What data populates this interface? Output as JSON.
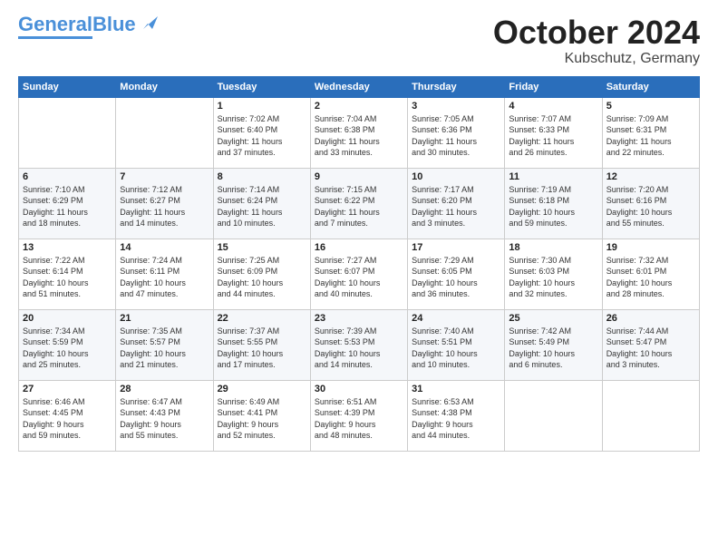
{
  "logo": {
    "text1": "General",
    "text2": "Blue"
  },
  "title": "October 2024",
  "subtitle": "Kubschutz, Germany",
  "days": [
    "Sunday",
    "Monday",
    "Tuesday",
    "Wednesday",
    "Thursday",
    "Friday",
    "Saturday"
  ],
  "weeks": [
    [
      {
        "day": "",
        "content": ""
      },
      {
        "day": "",
        "content": ""
      },
      {
        "day": "1",
        "content": "Sunrise: 7:02 AM\nSunset: 6:40 PM\nDaylight: 11 hours\nand 37 minutes."
      },
      {
        "day": "2",
        "content": "Sunrise: 7:04 AM\nSunset: 6:38 PM\nDaylight: 11 hours\nand 33 minutes."
      },
      {
        "day": "3",
        "content": "Sunrise: 7:05 AM\nSunset: 6:36 PM\nDaylight: 11 hours\nand 30 minutes."
      },
      {
        "day": "4",
        "content": "Sunrise: 7:07 AM\nSunset: 6:33 PM\nDaylight: 11 hours\nand 26 minutes."
      },
      {
        "day": "5",
        "content": "Sunrise: 7:09 AM\nSunset: 6:31 PM\nDaylight: 11 hours\nand 22 minutes."
      }
    ],
    [
      {
        "day": "6",
        "content": "Sunrise: 7:10 AM\nSunset: 6:29 PM\nDaylight: 11 hours\nand 18 minutes."
      },
      {
        "day": "7",
        "content": "Sunrise: 7:12 AM\nSunset: 6:27 PM\nDaylight: 11 hours\nand 14 minutes."
      },
      {
        "day": "8",
        "content": "Sunrise: 7:14 AM\nSunset: 6:24 PM\nDaylight: 11 hours\nand 10 minutes."
      },
      {
        "day": "9",
        "content": "Sunrise: 7:15 AM\nSunset: 6:22 PM\nDaylight: 11 hours\nand 7 minutes."
      },
      {
        "day": "10",
        "content": "Sunrise: 7:17 AM\nSunset: 6:20 PM\nDaylight: 11 hours\nand 3 minutes."
      },
      {
        "day": "11",
        "content": "Sunrise: 7:19 AM\nSunset: 6:18 PM\nDaylight: 10 hours\nand 59 minutes."
      },
      {
        "day": "12",
        "content": "Sunrise: 7:20 AM\nSunset: 6:16 PM\nDaylight: 10 hours\nand 55 minutes."
      }
    ],
    [
      {
        "day": "13",
        "content": "Sunrise: 7:22 AM\nSunset: 6:14 PM\nDaylight: 10 hours\nand 51 minutes."
      },
      {
        "day": "14",
        "content": "Sunrise: 7:24 AM\nSunset: 6:11 PM\nDaylight: 10 hours\nand 47 minutes."
      },
      {
        "day": "15",
        "content": "Sunrise: 7:25 AM\nSunset: 6:09 PM\nDaylight: 10 hours\nand 44 minutes."
      },
      {
        "day": "16",
        "content": "Sunrise: 7:27 AM\nSunset: 6:07 PM\nDaylight: 10 hours\nand 40 minutes."
      },
      {
        "day": "17",
        "content": "Sunrise: 7:29 AM\nSunset: 6:05 PM\nDaylight: 10 hours\nand 36 minutes."
      },
      {
        "day": "18",
        "content": "Sunrise: 7:30 AM\nSunset: 6:03 PM\nDaylight: 10 hours\nand 32 minutes."
      },
      {
        "day": "19",
        "content": "Sunrise: 7:32 AM\nSunset: 6:01 PM\nDaylight: 10 hours\nand 28 minutes."
      }
    ],
    [
      {
        "day": "20",
        "content": "Sunrise: 7:34 AM\nSunset: 5:59 PM\nDaylight: 10 hours\nand 25 minutes."
      },
      {
        "day": "21",
        "content": "Sunrise: 7:35 AM\nSunset: 5:57 PM\nDaylight: 10 hours\nand 21 minutes."
      },
      {
        "day": "22",
        "content": "Sunrise: 7:37 AM\nSunset: 5:55 PM\nDaylight: 10 hours\nand 17 minutes."
      },
      {
        "day": "23",
        "content": "Sunrise: 7:39 AM\nSunset: 5:53 PM\nDaylight: 10 hours\nand 14 minutes."
      },
      {
        "day": "24",
        "content": "Sunrise: 7:40 AM\nSunset: 5:51 PM\nDaylight: 10 hours\nand 10 minutes."
      },
      {
        "day": "25",
        "content": "Sunrise: 7:42 AM\nSunset: 5:49 PM\nDaylight: 10 hours\nand 6 minutes."
      },
      {
        "day": "26",
        "content": "Sunrise: 7:44 AM\nSunset: 5:47 PM\nDaylight: 10 hours\nand 3 minutes."
      }
    ],
    [
      {
        "day": "27",
        "content": "Sunrise: 6:46 AM\nSunset: 4:45 PM\nDaylight: 9 hours\nand 59 minutes."
      },
      {
        "day": "28",
        "content": "Sunrise: 6:47 AM\nSunset: 4:43 PM\nDaylight: 9 hours\nand 55 minutes."
      },
      {
        "day": "29",
        "content": "Sunrise: 6:49 AM\nSunset: 4:41 PM\nDaylight: 9 hours\nand 52 minutes."
      },
      {
        "day": "30",
        "content": "Sunrise: 6:51 AM\nSunset: 4:39 PM\nDaylight: 9 hours\nand 48 minutes."
      },
      {
        "day": "31",
        "content": "Sunrise: 6:53 AM\nSunset: 4:38 PM\nDaylight: 9 hours\nand 44 minutes."
      },
      {
        "day": "",
        "content": ""
      },
      {
        "day": "",
        "content": ""
      }
    ]
  ]
}
